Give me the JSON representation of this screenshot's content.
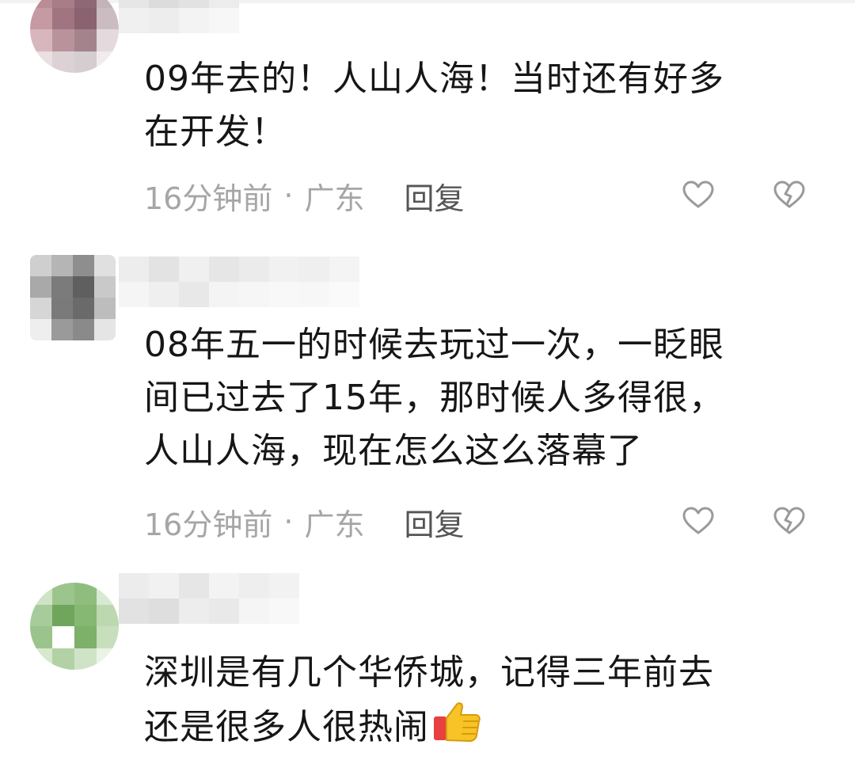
{
  "comments": [
    {
      "text_lines": [
        "09年去的！人山人海！当时还有好多",
        "在开发！"
      ],
      "time": "16分钟前",
      "separator": "·",
      "location": "广东",
      "reply_label": "回复"
    },
    {
      "text_lines": [
        "08年五一的时候去玩过一次，一眨眼",
        "间已过去了15年，那时候人多得很，",
        "人山人海，现在怎么这么落幕了"
      ],
      "time": "16分钟前",
      "separator": "·",
      "location": "广东",
      "reply_label": "回复"
    },
    {
      "text_lines": [
        "深圳是有几个华侨城，记得三年前去",
        "还是很多人很热闹"
      ],
      "emoji": "thumbs-up-emoji"
    }
  ],
  "icons": {
    "like": "heart-outline-icon",
    "dislike": "broken-heart-icon",
    "thumb": "thumbs-up-emoji"
  },
  "colors": {
    "meta_text": "#a6a6a6",
    "reply_text": "#555555",
    "icon_stroke": "#9a9a9a",
    "thumb_yellow": "#f7c325",
    "thumb_red": "#e8403f"
  }
}
